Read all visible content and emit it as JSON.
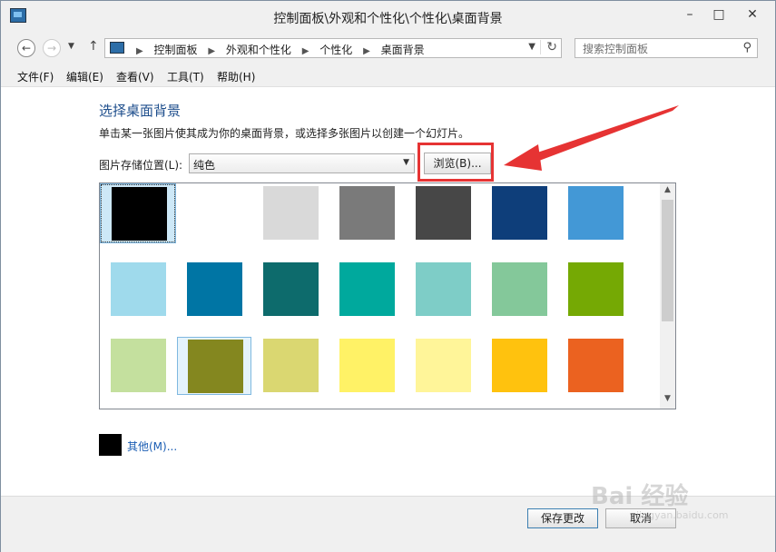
{
  "window": {
    "title": "控制面板\\外观和个性化\\个性化\\桌面背景"
  },
  "address": {
    "crumbs": [
      "控制面板",
      "外观和个性化",
      "个性化",
      "桌面背景"
    ]
  },
  "search": {
    "placeholder": "搜索控制面板"
  },
  "menu": [
    "文件(F)",
    "编辑(E)",
    "查看(V)",
    "工具(T)",
    "帮助(H)"
  ],
  "content": {
    "heading": "选择桌面背景",
    "description": "单击某一张图片使其成为你的桌面背景，或选择多张图片以创建一个幻灯片。",
    "location_label": "图片存储位置(L):",
    "location_value": "纯色",
    "browse_label": "浏览(B)...",
    "other_label": "其他(M)..."
  },
  "colors": [
    [
      "#000000",
      "#ffffff",
      "#d9d9d9",
      "#7a7a7a",
      "#474747",
      "#0e3e7a",
      "#4398d6"
    ],
    [
      "#9fdaec",
      "#0075a4",
      "#0d6b6c",
      "#00a99d",
      "#7ecdc7",
      "#84c89a",
      "#75a904"
    ],
    [
      "#c4e09e",
      "#84871f",
      "#dad771",
      "#fff266",
      "#fff599",
      "#ffc20e",
      "#eb6220"
    ]
  ],
  "selected_swatches": [
    "0-0",
    "2-1"
  ],
  "footer": {
    "save_label": "保存更改",
    "cancel_label": "取消"
  },
  "watermark": {
    "main": "Bai 经验",
    "sub": "jingyan.baidu.com"
  }
}
